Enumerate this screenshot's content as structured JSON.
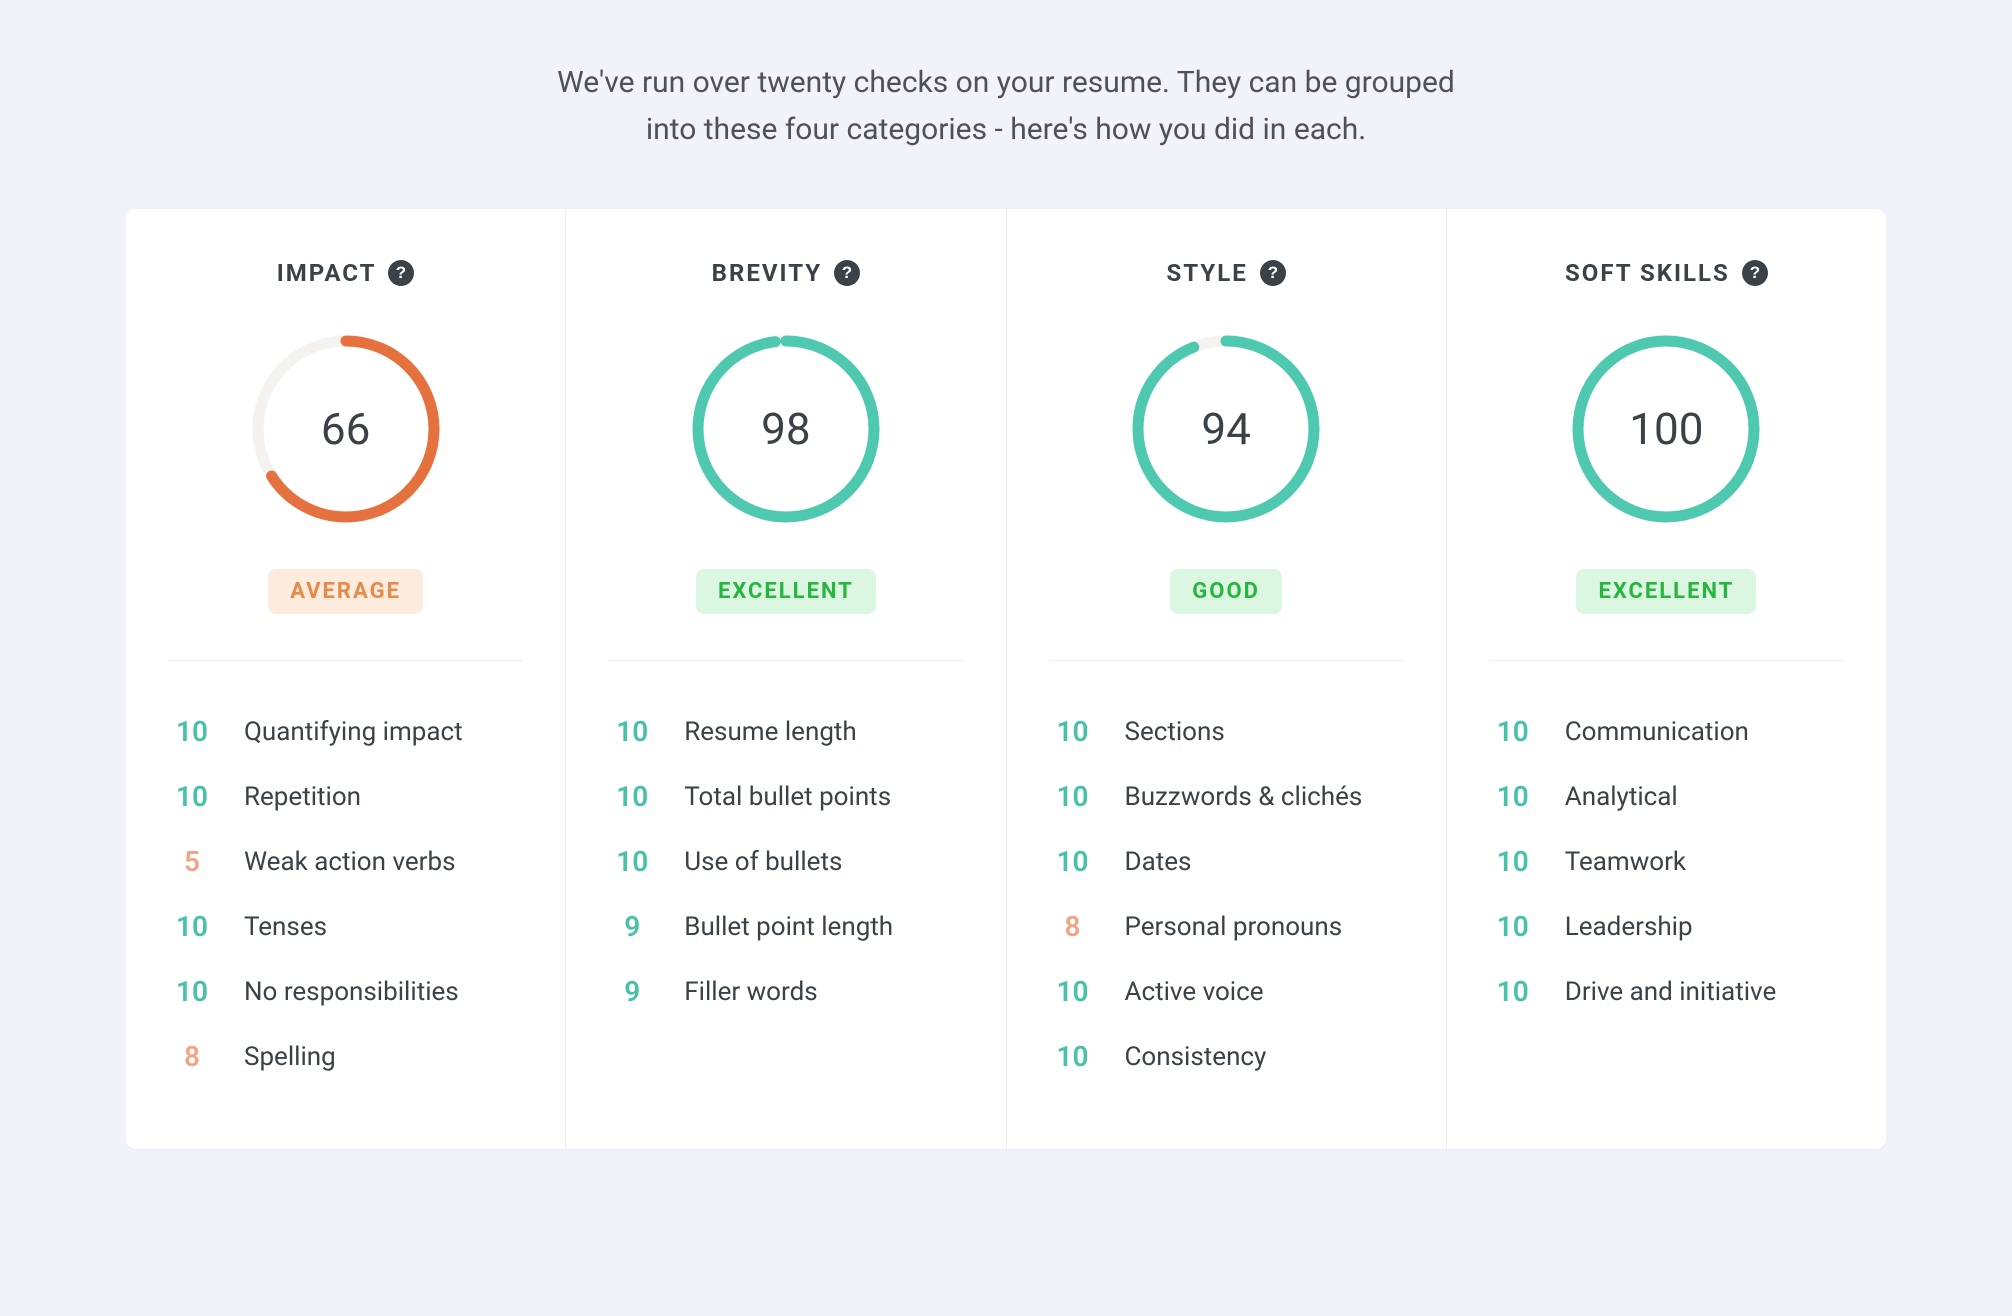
{
  "intro": {
    "line1": "We've run over twenty checks on your resume. They can be grouped",
    "line2": "into these four categories - here's how you did in each."
  },
  "colors": {
    "teal": "#4fc8b0",
    "orange": "#e5713e",
    "ring_bg": "#f5f2ef",
    "score_teal": "#47c2a8",
    "score_orange": "#f0a586"
  },
  "categories": [
    {
      "title": "IMPACT",
      "score": 66,
      "ring_color": "orange",
      "badge_label": "AVERAGE",
      "badge_class": "average",
      "checks": [
        {
          "score": 10,
          "score_class": "score-teal",
          "label": "Quantifying impact"
        },
        {
          "score": 10,
          "score_class": "score-teal",
          "label": "Repetition"
        },
        {
          "score": 5,
          "score_class": "score-orange",
          "label": "Weak action verbs"
        },
        {
          "score": 10,
          "score_class": "score-teal",
          "label": "Tenses"
        },
        {
          "score": 10,
          "score_class": "score-teal",
          "label": "No responsibilities"
        },
        {
          "score": 8,
          "score_class": "score-orange",
          "label": "Spelling"
        }
      ]
    },
    {
      "title": "BREVITY",
      "score": 98,
      "ring_color": "teal",
      "badge_label": "EXCELLENT",
      "badge_class": "excellent",
      "checks": [
        {
          "score": 10,
          "score_class": "score-teal",
          "label": "Resume length"
        },
        {
          "score": 10,
          "score_class": "score-teal",
          "label": "Total bullet points"
        },
        {
          "score": 10,
          "score_class": "score-teal",
          "label": "Use of bullets"
        },
        {
          "score": 9,
          "score_class": "score-teal",
          "label": "Bullet point length"
        },
        {
          "score": 9,
          "score_class": "score-teal",
          "label": "Filler words"
        }
      ]
    },
    {
      "title": "STYLE",
      "score": 94,
      "ring_color": "teal",
      "badge_label": "GOOD",
      "badge_class": "good",
      "checks": [
        {
          "score": 10,
          "score_class": "score-teal",
          "label": "Sections"
        },
        {
          "score": 10,
          "score_class": "score-teal",
          "label": "Buzzwords & clichés"
        },
        {
          "score": 10,
          "score_class": "score-teal",
          "label": "Dates"
        },
        {
          "score": 8,
          "score_class": "score-orange",
          "label": "Personal pronouns"
        },
        {
          "score": 10,
          "score_class": "score-teal",
          "label": "Active voice"
        },
        {
          "score": 10,
          "score_class": "score-teal",
          "label": "Consistency"
        }
      ]
    },
    {
      "title": "SOFT SKILLS",
      "score": 100,
      "ring_color": "teal",
      "badge_label": "EXCELLENT",
      "badge_class": "excellent",
      "checks": [
        {
          "score": 10,
          "score_class": "score-teal",
          "label": "Communication"
        },
        {
          "score": 10,
          "score_class": "score-teal",
          "label": "Analytical"
        },
        {
          "score": 10,
          "score_class": "score-teal",
          "label": "Teamwork"
        },
        {
          "score": 10,
          "score_class": "score-teal",
          "label": "Leadership"
        },
        {
          "score": 10,
          "score_class": "score-teal",
          "label": "Drive and initiative"
        }
      ]
    }
  ]
}
